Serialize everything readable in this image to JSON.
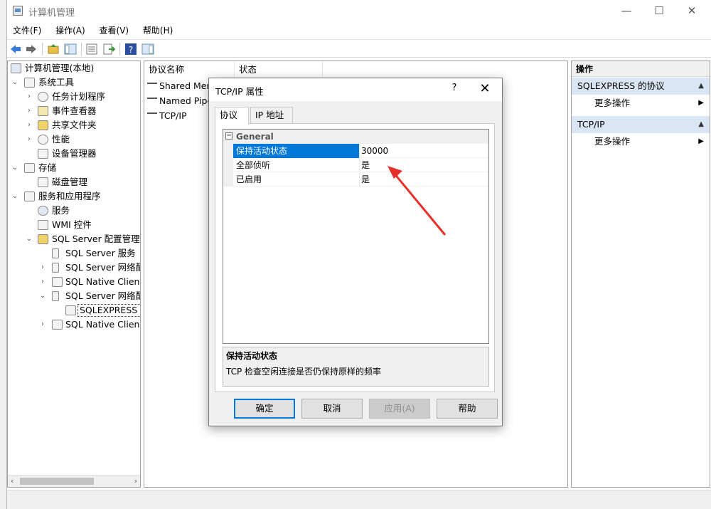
{
  "window": {
    "title": "计算机管理",
    "minimize": "—",
    "maximize": "☐",
    "close": "✕"
  },
  "menu": [
    "文件(F)",
    "操作(A)",
    "查看(V)",
    "帮助(H)"
  ],
  "tree": {
    "items": [
      {
        "label": "计算机管理(本地)",
        "icon": "computer-management-icon"
      },
      {
        "label": "系统工具",
        "icon": "tools-icon"
      },
      {
        "label": "任务计划程序",
        "icon": "clock-icon"
      },
      {
        "label": "事件查看器",
        "icon": "event-viewer-icon"
      },
      {
        "label": "共享文件夹",
        "icon": "shared-folder-icon"
      },
      {
        "label": "性能",
        "icon": "performance-icon"
      },
      {
        "label": "设备管理器",
        "icon": "device-manager-icon"
      },
      {
        "label": "存储",
        "icon": "storage-icon"
      },
      {
        "label": "磁盘管理",
        "icon": "disk-icon"
      },
      {
        "label": "服务和应用程序",
        "icon": "services-apps-icon"
      },
      {
        "label": "服务",
        "icon": "gear-icon"
      },
      {
        "label": "WMI 控件",
        "icon": "wmi-icon"
      },
      {
        "label": "SQL Server 配置管理器",
        "icon": "sql-config-icon"
      },
      {
        "label": "SQL Server 服务",
        "icon": "sql-service-icon"
      },
      {
        "label": "SQL Server 网络配",
        "icon": "network-config-icon"
      },
      {
        "label": "SQL Native Client",
        "icon": "native-client-icon"
      },
      {
        "label": "SQL Server 网络配",
        "icon": "network-config-icon"
      },
      {
        "label": "SQLEXPRESS 的",
        "icon": "protocol-icon"
      },
      {
        "label": "SQL Native Client",
        "icon": "native-client-icon"
      }
    ]
  },
  "list": {
    "columns": [
      "协议名称",
      "状态"
    ],
    "rows": [
      "Shared Mem",
      "Named Pipe",
      "TCP/IP"
    ]
  },
  "actions": {
    "header": "操作",
    "sections": [
      {
        "title": "SQLEXPRESS 的协议",
        "item": "更多操作"
      },
      {
        "title": "TCP/IP",
        "item": "更多操作"
      }
    ]
  },
  "dialog": {
    "title": "TCP/IP 属性",
    "help": "?",
    "close": "✕",
    "tabs": [
      "协议",
      "IP 地址"
    ],
    "category": "General",
    "properties": [
      {
        "name": "保持活动状态",
        "value": "30000"
      },
      {
        "name": "全部侦听",
        "value": "是"
      },
      {
        "name": "已启用",
        "value": "是"
      }
    ],
    "description_title": "保持活动状态",
    "description_text": "TCP 检查空闲连接是否仍保持原样的频率",
    "buttons": {
      "ok": "确定",
      "cancel": "取消",
      "apply": "应用(A)",
      "help": "帮助"
    }
  },
  "colors": {
    "selection": "#0078d7",
    "section_bg": "#dbe6f4",
    "arrow": "#e8302a"
  }
}
